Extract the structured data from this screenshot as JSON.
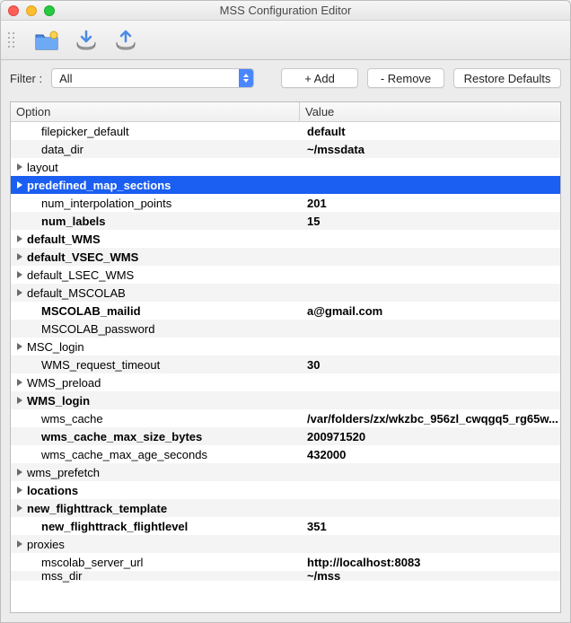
{
  "window": {
    "title": "MSS Configuration Editor"
  },
  "toolbar": {
    "icons": [
      "folder-new-icon",
      "import-icon",
      "export-icon"
    ]
  },
  "filter": {
    "label": "Filter :",
    "selected": "All",
    "buttons": {
      "add": "+ Add",
      "remove": "- Remove",
      "restore": "Restore Defaults"
    }
  },
  "columns": {
    "option": "Option",
    "value": "Value"
  },
  "rows": [
    {
      "option": "filepicker_default",
      "value": "default",
      "expandable": false,
      "bold_option": false,
      "bold_value": true,
      "indent": 1
    },
    {
      "option": "data_dir",
      "value": "~/mssdata",
      "expandable": false,
      "bold_option": false,
      "bold_value": true,
      "indent": 1
    },
    {
      "option": "layout",
      "value": "",
      "expandable": true,
      "bold_option": false,
      "bold_value": false,
      "indent": 0
    },
    {
      "option": "predefined_map_sections",
      "value": "",
      "expandable": true,
      "bold_option": true,
      "bold_value": false,
      "indent": 0,
      "selected": true
    },
    {
      "option": "num_interpolation_points",
      "value": "201",
      "expandable": false,
      "bold_option": false,
      "bold_value": true,
      "indent": 1
    },
    {
      "option": "num_labels",
      "value": "15",
      "expandable": false,
      "bold_option": true,
      "bold_value": true,
      "indent": 1
    },
    {
      "option": "default_WMS",
      "value": "",
      "expandable": true,
      "bold_option": true,
      "bold_value": false,
      "indent": 0
    },
    {
      "option": "default_VSEC_WMS",
      "value": "",
      "expandable": true,
      "bold_option": true,
      "bold_value": false,
      "indent": 0
    },
    {
      "option": "default_LSEC_WMS",
      "value": "",
      "expandable": true,
      "bold_option": false,
      "bold_value": false,
      "indent": 0
    },
    {
      "option": "default_MSCOLAB",
      "value": "",
      "expandable": true,
      "bold_option": false,
      "bold_value": false,
      "indent": 0
    },
    {
      "option": "MSCOLAB_mailid",
      "value": "a@gmail.com",
      "expandable": false,
      "bold_option": true,
      "bold_value": true,
      "indent": 1
    },
    {
      "option": "MSCOLAB_password",
      "value": "",
      "expandable": false,
      "bold_option": false,
      "bold_value": false,
      "indent": 1
    },
    {
      "option": "MSC_login",
      "value": "",
      "expandable": true,
      "bold_option": false,
      "bold_value": false,
      "indent": 0
    },
    {
      "option": "WMS_request_timeout",
      "value": "30",
      "expandable": false,
      "bold_option": false,
      "bold_value": true,
      "indent": 1
    },
    {
      "option": "WMS_preload",
      "value": "",
      "expandable": true,
      "bold_option": false,
      "bold_value": false,
      "indent": 0
    },
    {
      "option": "WMS_login",
      "value": "",
      "expandable": true,
      "bold_option": true,
      "bold_value": false,
      "indent": 0
    },
    {
      "option": "wms_cache",
      "value": "/var/folders/zx/wkzbc_956zl_cwqgq5_rg65w...",
      "expandable": false,
      "bold_option": false,
      "bold_value": true,
      "indent": 1
    },
    {
      "option": "wms_cache_max_size_bytes",
      "value": "200971520",
      "expandable": false,
      "bold_option": true,
      "bold_value": true,
      "indent": 1
    },
    {
      "option": "wms_cache_max_age_seconds",
      "value": "432000",
      "expandable": false,
      "bold_option": false,
      "bold_value": true,
      "indent": 1
    },
    {
      "option": "wms_prefetch",
      "value": "",
      "expandable": true,
      "bold_option": false,
      "bold_value": false,
      "indent": 0
    },
    {
      "option": "locations",
      "value": "",
      "expandable": true,
      "bold_option": true,
      "bold_value": false,
      "indent": 0
    },
    {
      "option": "new_flighttrack_template",
      "value": "",
      "expandable": true,
      "bold_option": true,
      "bold_value": false,
      "indent": 0
    },
    {
      "option": "new_flighttrack_flightlevel",
      "value": "351",
      "expandable": false,
      "bold_option": true,
      "bold_value": true,
      "indent": 1
    },
    {
      "option": "proxies",
      "value": "",
      "expandable": true,
      "bold_option": false,
      "bold_value": false,
      "indent": 0
    },
    {
      "option": "mscolab_server_url",
      "value": "http://localhost:8083",
      "expandable": false,
      "bold_option": false,
      "bold_value": true,
      "indent": 1
    },
    {
      "option": "mss_dir",
      "value": "~/mss",
      "expandable": false,
      "bold_option": false,
      "bold_value": true,
      "indent": 1,
      "cut": true
    }
  ]
}
